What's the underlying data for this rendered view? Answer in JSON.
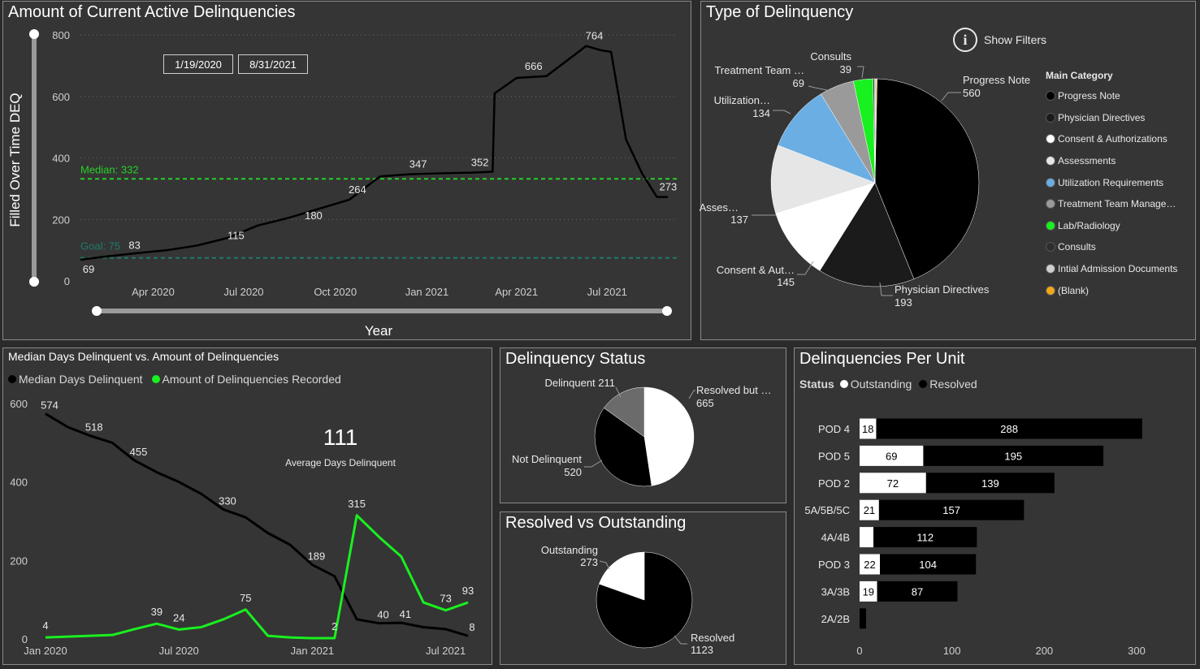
{
  "panel1": {
    "title": "Amount of Current Active Delinquencies",
    "ylabel": "Filled Over Time DEQ",
    "xlabel": "Year",
    "date_start": "1/19/2020",
    "date_end": "8/31/2021",
    "median_label": "Median: 332",
    "goal_label": "Goal: 75",
    "median_color": "#27d027",
    "goal_color": "#1f7a6a"
  },
  "panel2": {
    "title": "Type of Delinquency",
    "show_filters": "Show Filters",
    "legend_title": "Main Category",
    "legend": [
      {
        "name": "Progress Note",
        "color": "#000000"
      },
      {
        "name": "Physician Directives",
        "color": "#1b1b1b"
      },
      {
        "name": "Consent & Authorizations",
        "color": "#ffffff"
      },
      {
        "name": "Assessments",
        "color": "#e6e6e6"
      },
      {
        "name": "Utilization Requirements",
        "color": "#6aaee3"
      },
      {
        "name": "Treatment Team Manage…",
        "color": "#9a9a9a"
      },
      {
        "name": "Lab/Radiology",
        "color": "#19f01f"
      },
      {
        "name": "Consults",
        "color": "#2e2e2e"
      },
      {
        "name": "Intial Admission Documents",
        "color": "#cfcfcf"
      },
      {
        "name": "(Blank)",
        "color": "#f2a818"
      }
    ],
    "slice_labels": [
      {
        "name": "Progress Note",
        "value": "560"
      },
      {
        "name": "Physician Directives",
        "value": "193"
      },
      {
        "name": "Consent & Aut…",
        "value": "145"
      },
      {
        "name": "Asses…",
        "value": "137"
      },
      {
        "name": "Utilization…",
        "value": "134"
      },
      {
        "name": "Treatment Team …",
        "value": "69"
      },
      {
        "name": "Consults",
        "value": "39"
      }
    ]
  },
  "panel3": {
    "title": "Median Days Delinquent vs. Amount of Delinquencies",
    "legend_1": "Median Days Delinquent",
    "legend_2": "Amount of Delinquencies Recorded",
    "kpi_value": "111",
    "kpi_label": "Average Days Delinquent"
  },
  "panel4": {
    "title": "Delinquency Status",
    "labels": [
      {
        "name": "Resolved but …",
        "value": "665"
      },
      {
        "name": "Delinquent",
        "value": "211"
      },
      {
        "name": "Not Delinquent",
        "value": "520"
      }
    ]
  },
  "panel5": {
    "title": "Resolved vs Outstanding",
    "labels": [
      {
        "name": "Outstanding",
        "value": "273"
      },
      {
        "name": "Resolved",
        "value": "1123"
      }
    ]
  },
  "panel6": {
    "title": "Delinquencies Per Unit",
    "status_label": "Status",
    "legend_1": "Outstanding",
    "legend_2": "Resolved"
  },
  "chart_data": [
    {
      "type": "line",
      "title": "Amount of Current Active Delinquencies",
      "xlabel": "Year",
      "ylabel": "Filled Over Time DEQ",
      "ylim": [
        0,
        800
      ],
      "yticks": [
        "0",
        "200",
        "400",
        "600",
        "800"
      ],
      "xticks": [
        "Apr 2020",
        "Jul 2020",
        "Oct 2020",
        "Jan 2021",
        "Apr 2021",
        "Jul 2021"
      ],
      "series": [
        {
          "x": [
            "2020-01-19",
            "2020-02-15",
            "2020-03-15",
            "2020-04-15",
            "2020-05-15",
            "2020-06-15",
            "2020-07-15",
            "2020-08-15",
            "2020-09-15",
            "2020-10-15",
            "2020-11-15",
            "2020-12-15",
            "2021-01-15",
            "2021-02-15",
            "2021-03-08",
            "2021-03-10",
            "2021-04-01",
            "2021-05-01",
            "2021-05-15",
            "2021-06-10",
            "2021-06-25",
            "2021-07-05",
            "2021-07-20",
            "2021-08-05",
            "2021-08-20",
            "2021-08-31"
          ],
          "values": [
            69,
            80,
            90,
            100,
            115,
            140,
            180,
            205,
            235,
            264,
            340,
            347,
            350,
            352,
            355,
            610,
            660,
            666,
            700,
            764,
            750,
            745,
            460,
            350,
            273,
            273
          ]
        }
      ],
      "annotations": [
        69,
        83,
        115,
        180,
        264,
        347,
        352,
        666,
        764,
        273
      ],
      "reference_lines": [
        {
          "label": "Median: 332",
          "value": 332
        },
        {
          "label": "Goal: 75",
          "value": 75
        }
      ]
    },
    {
      "type": "pie",
      "title": "Type of Delinquency",
      "categories": [
        "Progress Note",
        "Physician Directives",
        "Consent & Authorizations",
        "Assessments",
        "Utilization Requirements",
        "Treatment Team Manage…",
        "Lab/Radiology",
        "Consults",
        "Intial Admission Documents",
        "(Blank)"
      ],
      "values": [
        560,
        193,
        145,
        137,
        134,
        69,
        39,
        3,
        3,
        2
      ]
    },
    {
      "type": "line",
      "title": "Median Days Delinquent vs. Amount of Delinquencies",
      "ylim": [
        0,
        600
      ],
      "yticks": [
        "0",
        "200",
        "400",
        "600"
      ],
      "xticks": [
        "Jan 2020",
        "Jul 2020",
        "Jan 2021",
        "Jul 2021"
      ],
      "x": [
        "2020-01",
        "2020-02",
        "2020-03",
        "2020-04",
        "2020-05",
        "2020-06",
        "2020-07",
        "2020-08",
        "2020-09",
        "2020-10",
        "2020-11",
        "2020-12",
        "2021-01",
        "2021-02",
        "2021-03",
        "2021-04",
        "2021-05",
        "2021-06",
        "2021-07",
        "2021-08"
      ],
      "series": [
        {
          "name": "Median Days Delinquent",
          "values": [
            574,
            540,
            518,
            500,
            455,
            425,
            400,
            370,
            330,
            310,
            270,
            240,
            189,
            160,
            50,
            40,
            41,
            30,
            25,
            8
          ]
        },
        {
          "name": "Amount of Delinquencies Recorded",
          "values": [
            4,
            6,
            8,
            10,
            25,
            39,
            24,
            30,
            50,
            75,
            8,
            4,
            2,
            2,
            315,
            260,
            210,
            93,
            73,
            93
          ]
        }
      ],
      "data_labels": {
        "median": [
          574,
          518,
          455,
          330,
          189,
          40,
          41,
          8
        ],
        "amount": [
          4,
          39,
          24,
          75,
          2,
          315,
          73,
          93
        ]
      }
    },
    {
      "type": "pie",
      "title": "Delinquency Status",
      "categories": [
        "Resolved but …",
        "Not Delinquent",
        "Delinquent"
      ],
      "values": [
        665,
        520,
        211
      ]
    },
    {
      "type": "pie",
      "title": "Resolved vs Outstanding",
      "categories": [
        "Resolved",
        "Outstanding"
      ],
      "values": [
        1123,
        273
      ]
    },
    {
      "type": "bar",
      "title": "Delinquencies Per Unit",
      "orientation": "horizontal",
      "stacked": true,
      "categories": [
        "POD 4",
        "POD 5",
        "POD 2",
        "5A/5B/5C",
        "4A/4B",
        "POD 3",
        "3A/3B",
        "2A/2B"
      ],
      "series": [
        {
          "name": "Outstanding",
          "values": [
            18,
            69,
            72,
            21,
            15,
            22,
            19,
            0
          ]
        },
        {
          "name": "Resolved",
          "values": [
            288,
            195,
            139,
            157,
            112,
            104,
            87,
            7
          ]
        }
      ],
      "value_labels": {
        "Outstanding": [
          "18",
          "69",
          "72",
          "21",
          "",
          "22",
          "19",
          ""
        ],
        "Resolved": [
          "288",
          "195",
          "139",
          "157",
          "112",
          "104",
          "87",
          ""
        ]
      },
      "xlim": [
        0,
        300
      ],
      "xticks": [
        "0",
        "100",
        "200",
        "300"
      ]
    }
  ]
}
